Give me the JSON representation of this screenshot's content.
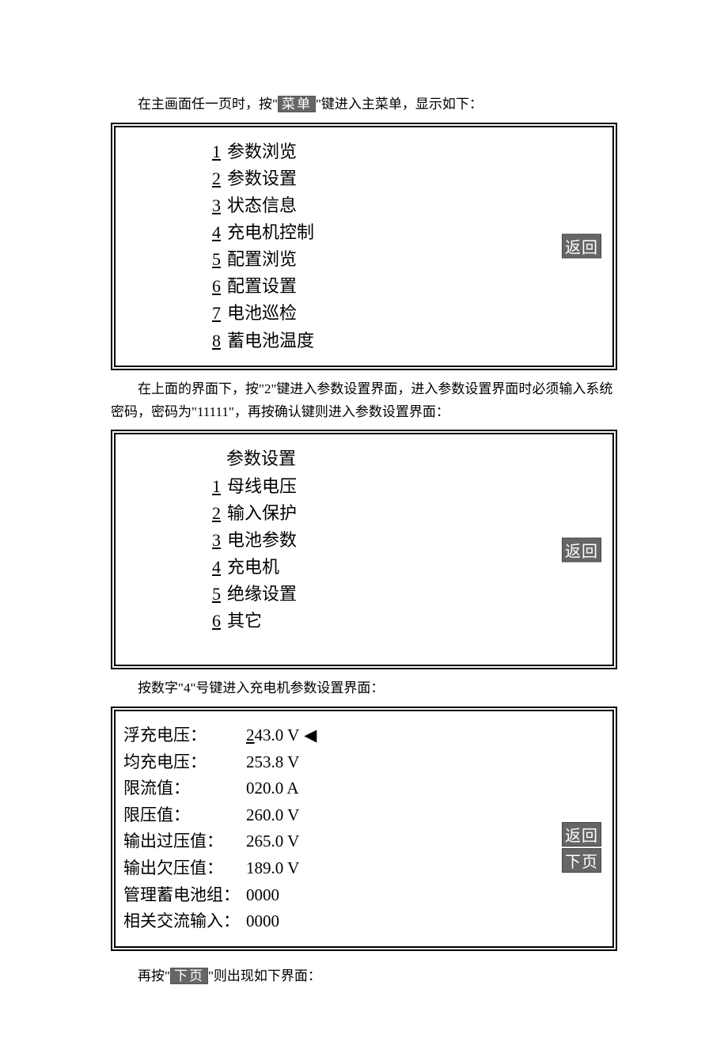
{
  "intro1_a": "在主画面任一页时，按\"",
  "intro1_btn": "菜单",
  "intro1_b": "\"键进入主菜单，显示如下：",
  "menu1": {
    "items": [
      {
        "num": "1",
        "label": "参数浏览"
      },
      {
        "num": "2",
        "label": "参数设置"
      },
      {
        "num": "3",
        "label": "状态信息"
      },
      {
        "num": "4",
        "label": "充电机控制"
      },
      {
        "num": "5",
        "label": "配置浏览"
      },
      {
        "num": "6",
        "label": "配置设置"
      },
      {
        "num": "7",
        "label": "电池巡检"
      },
      {
        "num": "8",
        "label": "蓄电池温度"
      }
    ],
    "back": "返回"
  },
  "intro2": "在上面的界面下，按\"2\"键进入参数设置界面，进入参数设置界面时必须输入系统密码，密码为\"11111\"，再按确认键则进入参数设置界面：",
  "menu2": {
    "title": "参数设置",
    "items": [
      {
        "num": "1",
        "label": "母线电压"
      },
      {
        "num": "2",
        "label": "输入保护"
      },
      {
        "num": "3",
        "label": "电池参数"
      },
      {
        "num": "4",
        "label": "充电机"
      },
      {
        "num": "5",
        "label": "绝缘设置"
      },
      {
        "num": "6",
        "label": "其它"
      }
    ],
    "back": "返回"
  },
  "intro3": "按数字\"4\"号键进入充电机参数设置界面：",
  "params": {
    "rows": [
      {
        "label": "浮充电压：",
        "val_first": "2",
        "val_rest": "43.0 V",
        "cursor": true
      },
      {
        "label": "均充电压：",
        "val_first": "",
        "val_rest": "253.8 V",
        "cursor": false
      },
      {
        "label": "限流值：",
        "val_first": "",
        "val_rest": "020.0 A",
        "cursor": false
      },
      {
        "label": "限压值：",
        "val_first": "",
        "val_rest": "260.0 V",
        "cursor": false
      },
      {
        "label": "输出过压值：",
        "val_first": "",
        "val_rest": "265.0 V",
        "cursor": false
      },
      {
        "label": "输出欠压值：",
        "val_first": "",
        "val_rest": "189.0 V",
        "cursor": false
      },
      {
        "label": "管理蓄电池组：",
        "val_first": "",
        "val_rest": "0000",
        "cursor": false
      },
      {
        "label": "相关交流输入：",
        "val_first": "",
        "val_rest": "0000",
        "cursor": false
      }
    ],
    "back": "返回",
    "next": "下页"
  },
  "intro4_a": "再按\"",
  "intro4_btn": "下页",
  "intro4_b": "\"则出现如下界面："
}
